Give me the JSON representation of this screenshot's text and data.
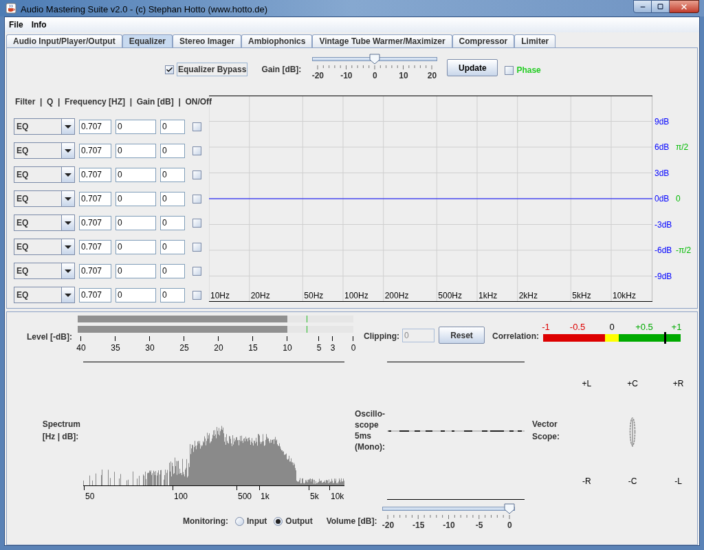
{
  "window": {
    "title": "Audio Mastering Suite v2.0 - (c) Stephan Hotto (www.hotto.de)"
  },
  "menu": [
    "File",
    "Info"
  ],
  "tabs": [
    {
      "label": "Audio Input/Player/Output",
      "selected": false
    },
    {
      "label": "Equalizer",
      "selected": true
    },
    {
      "label": "Stereo Imager",
      "selected": false
    },
    {
      "label": "Ambiophonics",
      "selected": false
    },
    {
      "label": "Vintage Tube Warmer/Maximizer",
      "selected": false
    },
    {
      "label": "Compressor",
      "selected": false
    },
    {
      "label": "Limiter",
      "selected": false
    }
  ],
  "equalizer": {
    "bypass": {
      "label": "Equalizer Bypass",
      "checked": true
    },
    "gain": {
      "label": "Gain [dB]:",
      "level": 0.5,
      "ticks": [
        "-20",
        "-10",
        "0",
        "10",
        "20"
      ]
    },
    "update_button": "Update",
    "phase": {
      "label": "Phase",
      "checked": false
    },
    "filter_header": "Filter  |  Q  |  Frequency [HZ]  |  Gain [dB]  |  ON/Off",
    "filters": [
      {
        "type": "EQ",
        "q": "0.707",
        "frequency": "0",
        "gain": "0",
        "on": false
      },
      {
        "type": "EQ",
        "q": "0.707",
        "frequency": "0",
        "gain": "0",
        "on": false
      },
      {
        "type": "EQ",
        "q": "0.707",
        "frequency": "0",
        "gain": "0",
        "on": false
      },
      {
        "type": "EQ",
        "q": "0.707",
        "frequency": "0",
        "gain": "0",
        "on": false
      },
      {
        "type": "EQ",
        "q": "0.707",
        "frequency": "0",
        "gain": "0",
        "on": false
      },
      {
        "type": "EQ",
        "q": "0.707",
        "frequency": "0",
        "gain": "0",
        "on": false
      },
      {
        "type": "EQ",
        "q": "0.707",
        "frequency": "0",
        "gain": "0",
        "on": false
      },
      {
        "type": "EQ",
        "q": "0.707",
        "frequency": "0",
        "gain": "0",
        "on": false
      }
    ],
    "graph": {
      "x_labels": [
        "10Hz",
        "20Hz",
        "50Hz",
        "100Hz",
        "200Hz",
        "500Hz",
        "1kHz",
        "2kHz",
        "5kHz",
        "10kHz"
      ],
      "y_labels": [
        "9dB",
        "6dB",
        "3dB",
        "0dB",
        "-3dB",
        "-6dB",
        "-9dB"
      ],
      "phase_labels": [
        "π/2",
        "0",
        "-π/2"
      ]
    }
  },
  "level_meter": {
    "label": "Level [-dB]:",
    "channels": [
      {
        "level": 0.76,
        "peak": {
          "level": 0.83
        }
      },
      {
        "level": 0.76,
        "peak": {
          "level": 0.83
        }
      }
    ],
    "ticks": [
      "40",
      "35",
      "30",
      "25",
      "20",
      "15",
      "10",
      "5",
      "3",
      "0"
    ]
  },
  "clipping": {
    "label": "Clipping:",
    "value": "0",
    "reset_button": "Reset"
  },
  "correlation": {
    "label": "Correlation:",
    "level": 0.885,
    "ticks": [
      {
        "text": "-1",
        "color": "#dd0000"
      },
      {
        "text": "-0.5",
        "color": "#dd0000"
      },
      {
        "text": "0",
        "color": "#000000"
      },
      {
        "text": "+0.5",
        "color": "#00aa00"
      },
      {
        "text": "+1",
        "color": "#00aa00"
      }
    ]
  },
  "spectrum": {
    "label": "Spectrum\n[Hz | dB]:",
    "ticks": [
      "50",
      "100",
      "500",
      "1k",
      "5k",
      "10k"
    ]
  },
  "oscilloscope": {
    "label": "Oscillo-\nscope\n5ms\n(Mono):"
  },
  "vector_scope": {
    "label": "Vector\nScope:",
    "top_labels": [
      "+L",
      "+C",
      "+R"
    ],
    "bottom_labels": [
      "-R",
      "-C",
      "-L"
    ]
  },
  "monitoring": {
    "label": "Monitoring:",
    "options": [
      {
        "label": "Input",
        "selected": false
      },
      {
        "label": "Output",
        "selected": true
      }
    ]
  },
  "volume": {
    "label": "Volume [dB]:",
    "level": 1.0,
    "ticks": [
      "-20",
      "-15",
      "-10",
      "-5",
      "0"
    ]
  }
}
